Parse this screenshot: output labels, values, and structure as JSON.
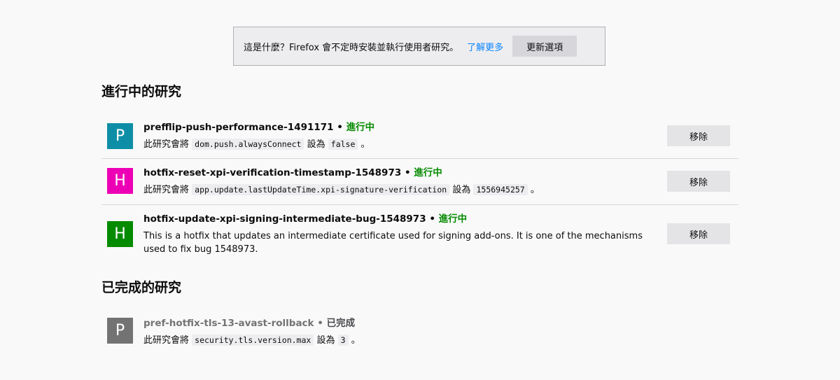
{
  "info_bar": {
    "text": "這是什麼？Firefox 會不定時安裝並執行使用者研究。",
    "learn_more": "了解更多",
    "update_button": "更新選項"
  },
  "active_section": {
    "title": "進行中的研究",
    "studies": [
      {
        "letter": "P",
        "color": "#0e8ea6",
        "name": "prefflip-push-performance-1491171",
        "separator": "•",
        "status": "進行中",
        "desc_prefix": "此研究會將",
        "pref": "dom.push.alwaysConnect",
        "desc_mid": "設為",
        "value": "false",
        "desc_suffix": "。",
        "remove": "移除"
      },
      {
        "letter": "H",
        "color": "#ed00b5",
        "name": "hotfix-reset-xpi-verification-timestamp-1548973",
        "separator": "•",
        "status": "進行中",
        "desc_prefix": "此研究會將",
        "pref": "app.update.lastUpdateTime.xpi-signature-verification",
        "desc_mid": "設為",
        "value": "1556945257",
        "desc_suffix": "。",
        "remove": "移除"
      },
      {
        "letter": "H",
        "color": "#058b00",
        "name": "hotfix-update-xpi-signing-intermediate-bug-1548973",
        "separator": "•",
        "status": "進行中",
        "description": "This is a hotfix that updates an intermediate certificate used for signing add-ons. It is one of the mechanisms used to fix bug 1548973.",
        "remove": "移除"
      }
    ]
  },
  "completed_section": {
    "title": "已完成的研究",
    "studies": [
      {
        "letter": "P",
        "color": "#737373",
        "name": "pref-hotfix-tls-13-avast-rollback",
        "separator": "•",
        "status": "已完成",
        "desc_prefix": "此研究會將",
        "pref": "security.tls.version.max",
        "desc_mid": "設為",
        "value": "3",
        "desc_suffix": "。"
      }
    ]
  }
}
